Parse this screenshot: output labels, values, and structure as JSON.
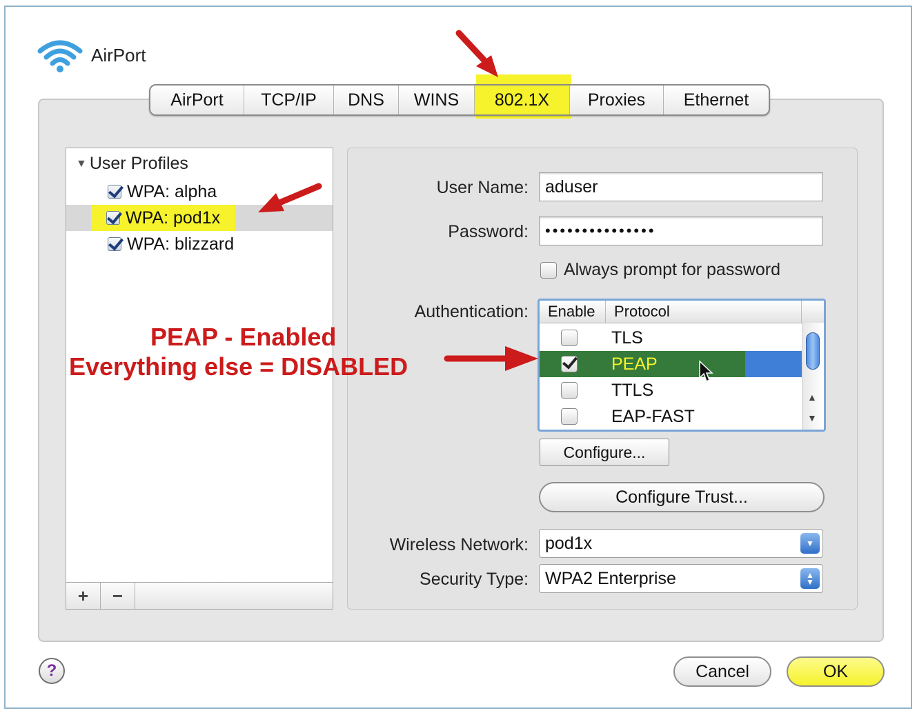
{
  "window": {
    "title": "AirPort"
  },
  "tabs": [
    {
      "label": "AirPort",
      "selected": false
    },
    {
      "label": "TCP/IP",
      "selected": false
    },
    {
      "label": "DNS",
      "selected": false
    },
    {
      "label": "WINS",
      "selected": false
    },
    {
      "label": "802.1X",
      "selected": true
    },
    {
      "label": "Proxies",
      "selected": false
    },
    {
      "label": "Ethernet",
      "selected": false
    }
  ],
  "sidebar": {
    "header": "User Profiles",
    "items": [
      {
        "label": "WPA: alpha",
        "checked": true,
        "selected": false
      },
      {
        "label": "WPA: pod1x",
        "checked": true,
        "selected": true
      },
      {
        "label": "WPA: blizzard",
        "checked": true,
        "selected": false
      }
    ],
    "add_label": "+",
    "remove_label": "−"
  },
  "form": {
    "user_name_label": "User Name:",
    "user_name_value": "aduser",
    "password_label": "Password:",
    "password_value": "•••••••••••••••",
    "always_prompt_label": "Always prompt for password",
    "always_prompt_checked": false,
    "authentication_label": "Authentication:",
    "auth_columns": {
      "enable": "Enable",
      "protocol": "Protocol"
    },
    "auth_protocols": [
      {
        "name": "TLS",
        "enabled": false,
        "selected": false
      },
      {
        "name": "PEAP",
        "enabled": true,
        "selected": true
      },
      {
        "name": "TTLS",
        "enabled": false,
        "selected": false
      },
      {
        "name": "EAP-FAST",
        "enabled": false,
        "selected": false
      }
    ],
    "configure_label": "Configure...",
    "configure_trust_label": "Configure Trust...",
    "wireless_network_label": "Wireless Network:",
    "wireless_network_value": "pod1x",
    "security_type_label": "Security Type:",
    "security_type_value": "WPA2 Enterprise"
  },
  "footer": {
    "help_label": "?",
    "cancel_label": "Cancel",
    "ok_label": "OK"
  },
  "annotation": {
    "line1": "PEAP - Enabled",
    "line2": "Everything else = DISABLED",
    "color": "#cc1b1b"
  },
  "colors": {
    "highlight": "#f6f22c",
    "selection": "#3f7fd8",
    "peap_row": "#357a3a"
  }
}
